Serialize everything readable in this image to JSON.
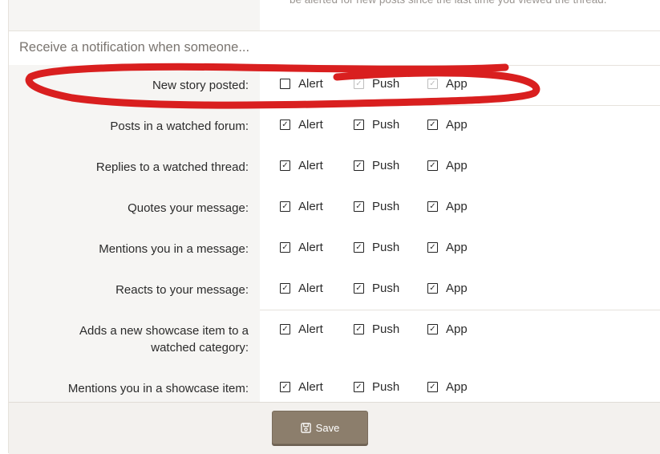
{
  "top_hint": "be alerted for new posts since the last time you viewed the thread.",
  "section_header": "Receive a notification when someone...",
  "options": {
    "alert": "Alert",
    "push": "Push",
    "app": "App"
  },
  "rows": [
    {
      "label": "New story posted:",
      "alert": false,
      "push": true,
      "app": true,
      "push_disabled": true,
      "app_disabled": true
    },
    {
      "label": "Posts in a watched forum:",
      "alert": true,
      "push": true,
      "app": true
    },
    {
      "label": "Replies to a watched thread:",
      "alert": true,
      "push": true,
      "app": true
    },
    {
      "label": "Quotes your message:",
      "alert": true,
      "push": true,
      "app": true
    },
    {
      "label": "Mentions you in a message:",
      "alert": true,
      "push": true,
      "app": true
    },
    {
      "label": "Reacts to your message:",
      "alert": true,
      "push": true,
      "app": true
    },
    {
      "label_line1": "Adds a new showcase item to a",
      "label_line2": "watched category:",
      "alert": true,
      "push": true,
      "app": true
    },
    {
      "label": "Mentions you in a showcase item:",
      "alert": true,
      "push": true,
      "app": true
    }
  ],
  "footer": {
    "save_label": "Save",
    "save_icon": "save-icon"
  },
  "annotation_color": "#d91f1f"
}
